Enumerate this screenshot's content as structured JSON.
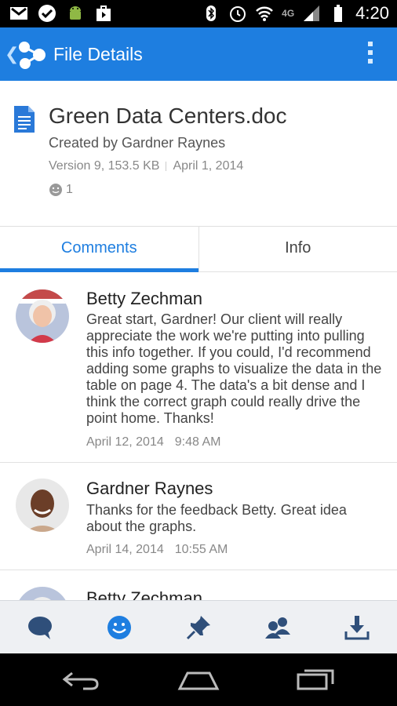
{
  "status_bar": {
    "time": "4:20",
    "network": "4G"
  },
  "app_bar": {
    "title": "File Details"
  },
  "file": {
    "name": "Green Data Centers.doc",
    "created_by": "Created by Gardner Raynes",
    "version_size": "Version 9, 153.5 KB",
    "date": "April 1, 2014",
    "likes": "1"
  },
  "tabs": [
    {
      "label": "Comments",
      "active": true
    },
    {
      "label": "Info",
      "active": false
    }
  ],
  "comments": [
    {
      "author": "Betty Zechman",
      "text": "Great start, Gardner! Our client will really appreciate the work we're putting into pulling this info together. If you could, I'd recommend adding some graphs to visualize the  data in the table on page 4. The data's a bit dense and I think the correct graph could really drive the point home. Thanks!",
      "date": "April 12, 2014",
      "time": "9:48 AM"
    },
    {
      "author": "Gardner Raynes",
      "text": "Thanks for the feedback Betty. Great idea about the graphs.",
      "date": "April 14, 2014",
      "time": "10:55 AM"
    },
    {
      "author": "Betty Zechman"
    }
  ],
  "actions": [
    "comment-icon",
    "like-icon",
    "pin-icon",
    "people-icon",
    "download-icon"
  ],
  "colors": {
    "accent": "#1e7ee0",
    "icon": "#2f4f7a"
  }
}
